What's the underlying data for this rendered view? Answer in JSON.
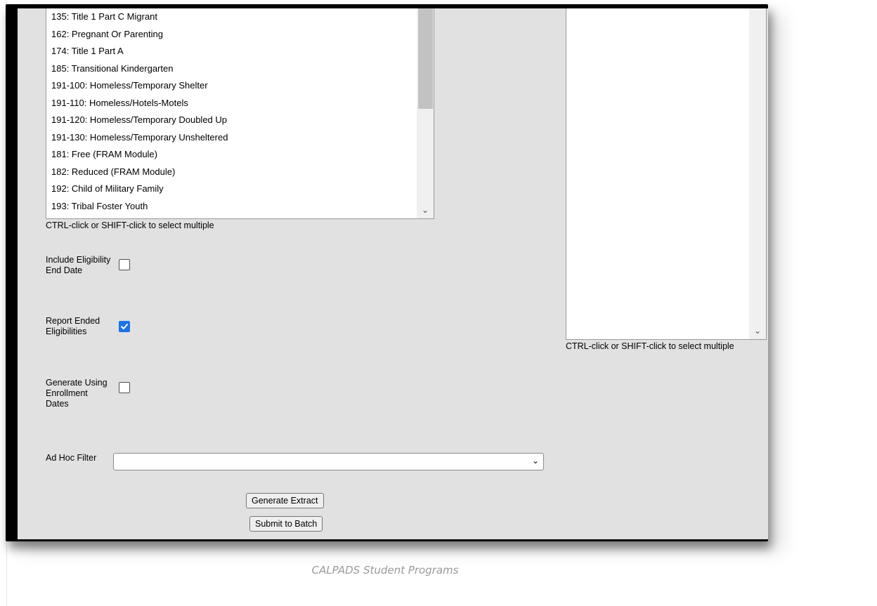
{
  "program_list": {
    "options": [
      "135: Title 1 Part C Migrant",
      "162: Pregnant Or Parenting",
      "174: Title 1 Part A",
      "185: Transitional Kindergarten",
      "191-100: Homeless/Temporary Shelter",
      "191-110: Homeless/Hotels-Motels",
      "191-120: Homeless/Temporary Doubled Up",
      "191-130: Homeless/Temporary Unsheltered",
      "181: Free (FRAM Module)",
      "182: Reduced (FRAM Module)",
      "192: Child of Military Family",
      "193: Tribal Foster Youth"
    ],
    "hint": "CTRL-click or SHIFT-click to select multiple"
  },
  "right_list": {
    "hint": "CTRL-click or SHIFT-click to select multiple"
  },
  "options": {
    "include_eligibility_end_date": {
      "label": "Include Eligibility End Date",
      "checked": false
    },
    "report_ended_eligibilities": {
      "label": "Report Ended Eligibilities",
      "checked": true
    },
    "generate_using_enrollment_dates": {
      "label": "Generate Using Enrollment Dates",
      "checked": false
    }
  },
  "ad_hoc_filter": {
    "label": "Ad Hoc Filter",
    "value": ""
  },
  "buttons": {
    "generate_extract": "Generate Extract",
    "submit_to_batch": "Submit to Batch"
  },
  "caption": "CALPADS Student Programs",
  "colors": {
    "panel": "#e1e1e1",
    "checkbox_checked": "#1a73e8",
    "caption": "#999999"
  },
  "icons": [
    "chevron-down-icon",
    "checkmark-icon"
  ]
}
